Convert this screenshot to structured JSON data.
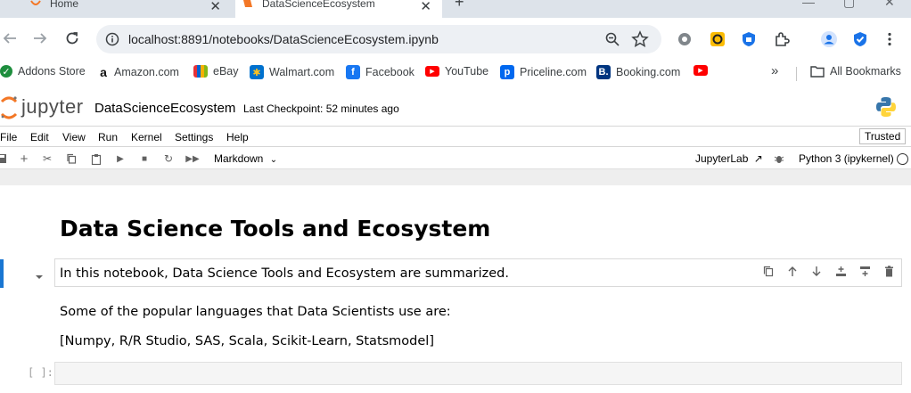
{
  "browser": {
    "tabs": [
      {
        "title": "Home",
        "active": false
      },
      {
        "title": "DataScienceEcosystem",
        "active": true
      }
    ],
    "address": "localhost:8891/notebooks/DataScienceEcosystem.ipynb",
    "bookmarks": [
      {
        "label": "Addons Store",
        "icon": "addons-icon",
        "color": "#1e8e3e"
      },
      {
        "label": "Amazon.com",
        "icon": "amazon-icon",
        "color": "#111111"
      },
      {
        "label": "eBay",
        "icon": "ebay-icon",
        "color": "#e53238"
      },
      {
        "label": "Walmart.com",
        "icon": "walmart-icon",
        "color": "#0071ce"
      },
      {
        "label": "Facebook",
        "icon": "facebook-icon",
        "color": "#1877f2"
      },
      {
        "label": "YouTube",
        "icon": "youtube-icon",
        "color": "#ff0000"
      },
      {
        "label": "Priceline.com",
        "icon": "priceline-icon",
        "color": "#0068ef"
      },
      {
        "label": "Booking.com",
        "icon": "booking-icon",
        "color": "#003580"
      }
    ],
    "more_bookmarks": "»",
    "all_bookmarks": "All Bookmarks"
  },
  "jupyter": {
    "logo_text": "jupyter",
    "notebook_title": "DataScienceEcosystem",
    "checkpoint": "Last Checkpoint: 52 minutes ago",
    "menu": [
      "File",
      "Edit",
      "View",
      "Run",
      "Kernel",
      "Settings",
      "Help"
    ],
    "trusted": "Trusted",
    "cell_type": "Markdown",
    "jupyterlab": "JupyterLab",
    "kernel": "Python 3 (ipykernel)",
    "accent": "#f37726"
  },
  "notebook": {
    "heading": "Data Science Tools and Ecosystem",
    "summary": "In this notebook, Data Science Tools and Ecosystem are summarized.",
    "languages_intro": "Some of the popular languages that Data Scientists use are:",
    "languages_list": "[Numpy, R/R Studio, SAS, Scala, Scikit-Learn, Statsmodel]",
    "prompt": "[ ]:"
  }
}
